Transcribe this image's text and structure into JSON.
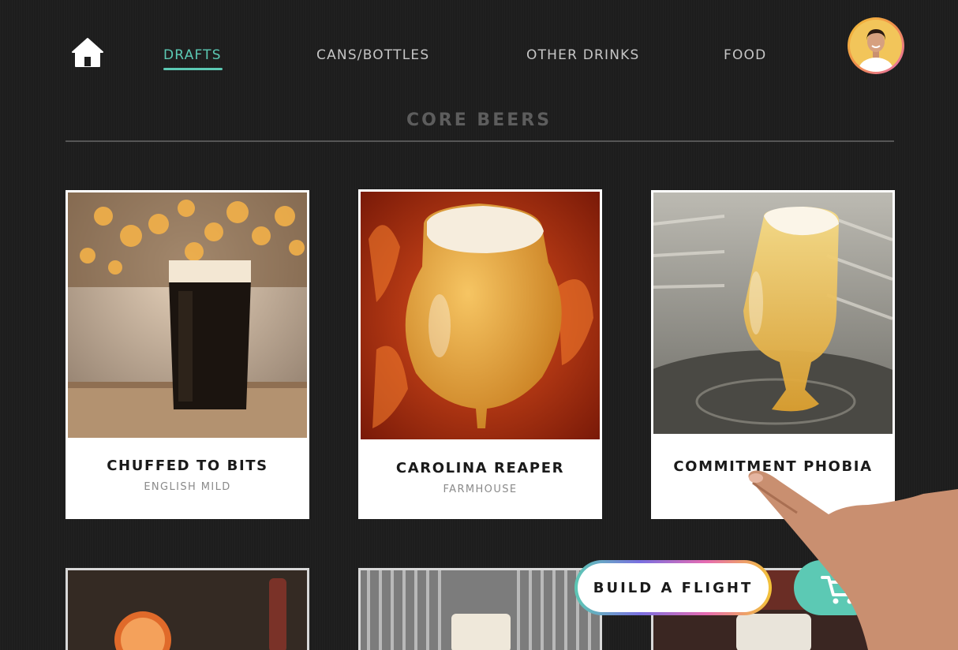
{
  "nav": {
    "items": [
      {
        "label": "DRAFTS",
        "active": true
      },
      {
        "label": "CANS/BOTTLES",
        "active": false
      },
      {
        "label": "OTHER DRINKS",
        "active": false
      },
      {
        "label": "FOOD",
        "active": false
      }
    ]
  },
  "section": {
    "title": "CORE BEERS"
  },
  "beers": [
    {
      "name": "CHUFFED TO BITS",
      "style": "ENGLISH MILD"
    },
    {
      "name": "CAROLINA REAPER",
      "style": "FARMHOUSE"
    },
    {
      "name": "COMMITMENT PHOBIA",
      "style": ""
    }
  ],
  "actions": {
    "build_flight": "BUILD A FLIGHT"
  },
  "colors": {
    "accent": "#5cc9b4",
    "background": "#1d1d1d",
    "card": "#ffffff"
  },
  "icons": {
    "home": "home-icon",
    "cart": "cart-icon",
    "avatar": "user-avatar"
  }
}
